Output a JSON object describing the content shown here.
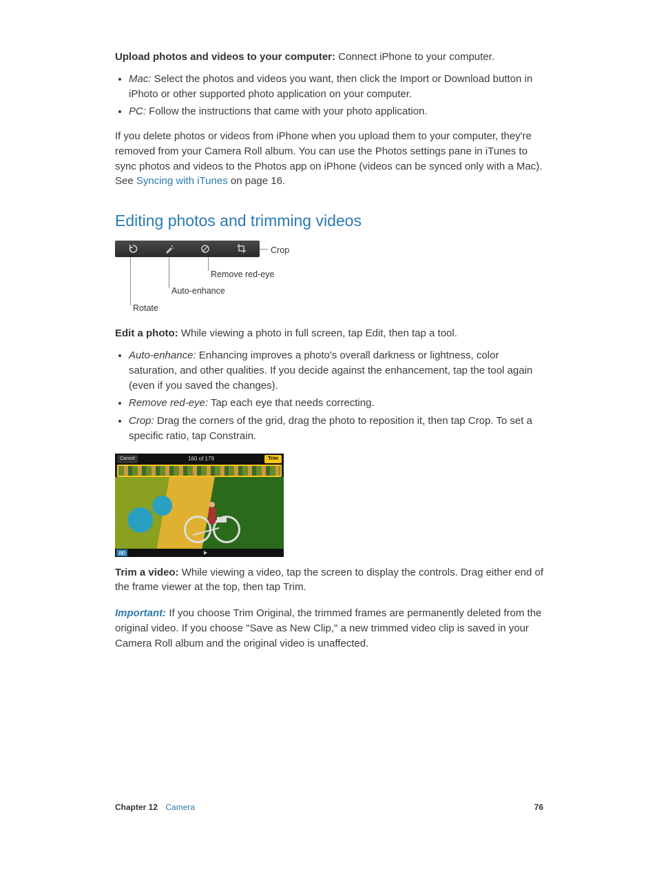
{
  "p1": {
    "title": "Upload photos and videos to your computer:",
    "rest": "  Connect iPhone to your computer."
  },
  "list1": {
    "mac_label": "Mac:",
    "mac_text": "  Select the photos and videos you want, then click the Import or Download button in iPhoto or other supported photo application on your computer.",
    "pc_label": "PC:",
    "pc_text": " Follow the instructions that came with your photo application."
  },
  "p2a": "If you delete photos or videos from iPhone when you upload them to your computer, they're removed from your Camera Roll album. You can use the Photos settings pane in iTunes to sync photos and videos to the Photos app on iPhone (videos can be synced only with a Mac). See ",
  "p2link": "Syncing with iTunes",
  "p2b": " on page 16.",
  "heading": "Editing photos and trimming videos",
  "callouts": {
    "crop": "Crop",
    "redeye": "Remove red-eye",
    "enhance": "Auto-enhance",
    "rotate": "Rotate"
  },
  "p3": {
    "title": "Edit a photo:",
    "rest": "  While viewing a photo in full screen, tap Edit, then tap a tool."
  },
  "list2": {
    "a_label": "Auto-enhance:",
    "a_text": "  Enhancing improves a photo's overall darkness or lightness, color saturation, and other qualities. If you decide against the enhancement, tap the tool again (even if you saved the changes).",
    "b_label": "Remove red-eye:",
    "b_text": "  Tap each eye that needs correcting.",
    "c_label": "Crop:",
    "c_text": "  Drag the corners of the grid, drag the photo to reposition it, then tap Crop. To set a specific ratio, tap Constrain."
  },
  "video": {
    "cancel": "Cancel",
    "count": "160 of 179",
    "trim": "Trim"
  },
  "p4": {
    "title": "Trim a video:",
    "rest": "  While viewing a video, tap the screen to display the controls. Drag either end of the frame viewer at the top, then tap Trim."
  },
  "p5": {
    "title": "Important:",
    "rest": "  If you choose Trim Original, the trimmed frames are permanently deleted from the original video. If you choose \"Save as New Clip,\" a new trimmed video clip is saved in your Camera Roll album and the original video is unaffected."
  },
  "footer": {
    "chapter": "Chapter  12",
    "name": "Camera",
    "page": "76"
  }
}
